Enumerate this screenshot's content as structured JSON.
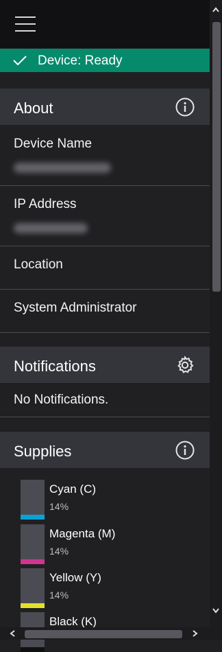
{
  "status": {
    "text": "Device: Ready",
    "color": "#068a6c"
  },
  "about": {
    "title": "About",
    "icon": "info-icon",
    "rows": [
      {
        "label": "Device Name",
        "value_obscured": true
      },
      {
        "label": "IP Address",
        "value_obscured": true
      },
      {
        "label": "Location"
      },
      {
        "label": "System Administrator"
      }
    ]
  },
  "notifications": {
    "title": "Notifications",
    "icon": "gear-icon",
    "empty_text": "No Notifications."
  },
  "supplies": {
    "title": "Supplies",
    "icon": "info-icon",
    "items": [
      {
        "name": "Cyan (C)",
        "percent": "14%",
        "level": 0.14,
        "color": "#0aa2d6"
      },
      {
        "name": "Magenta (M)",
        "percent": "14%",
        "level": 0.14,
        "color": "#d0358f"
      },
      {
        "name": "Yellow (Y)",
        "percent": "14%",
        "level": 0.14,
        "color": "#e4e02a"
      },
      {
        "name": "Black (K)",
        "percent": "",
        "level": 0.14,
        "color": "#111111"
      }
    ]
  }
}
